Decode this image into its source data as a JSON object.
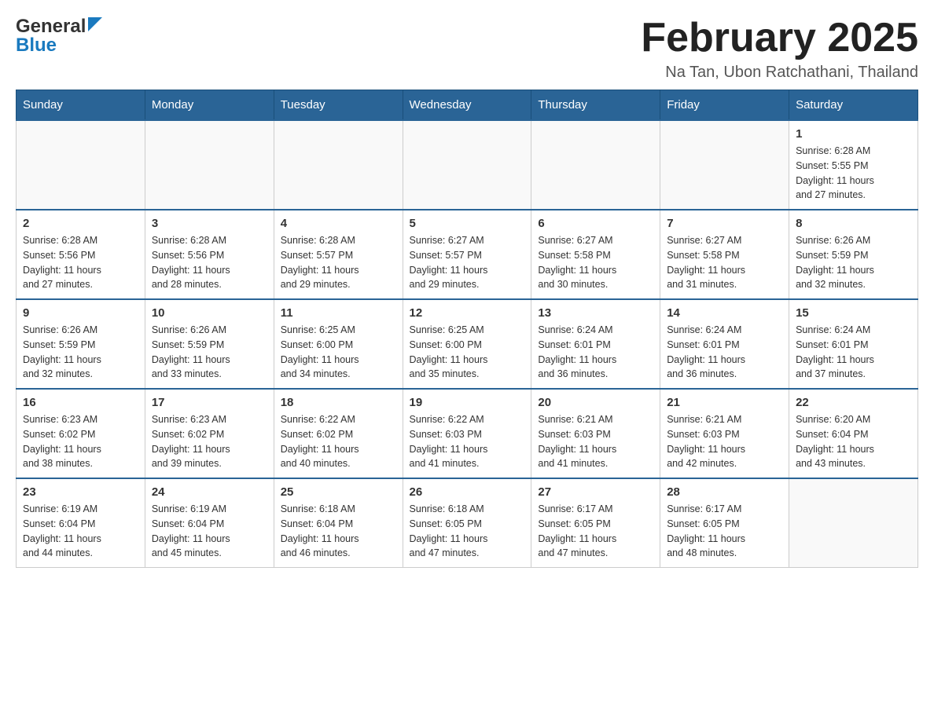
{
  "header": {
    "logo_general": "General",
    "logo_blue": "Blue",
    "month_title": "February 2025",
    "location": "Na Tan, Ubon Ratchathani, Thailand"
  },
  "days_of_week": [
    "Sunday",
    "Monday",
    "Tuesday",
    "Wednesday",
    "Thursday",
    "Friday",
    "Saturday"
  ],
  "weeks": [
    [
      {
        "day": "",
        "info": ""
      },
      {
        "day": "",
        "info": ""
      },
      {
        "day": "",
        "info": ""
      },
      {
        "day": "",
        "info": ""
      },
      {
        "day": "",
        "info": ""
      },
      {
        "day": "",
        "info": ""
      },
      {
        "day": "1",
        "info": "Sunrise: 6:28 AM\nSunset: 5:55 PM\nDaylight: 11 hours\nand 27 minutes."
      }
    ],
    [
      {
        "day": "2",
        "info": "Sunrise: 6:28 AM\nSunset: 5:56 PM\nDaylight: 11 hours\nand 27 minutes."
      },
      {
        "day": "3",
        "info": "Sunrise: 6:28 AM\nSunset: 5:56 PM\nDaylight: 11 hours\nand 28 minutes."
      },
      {
        "day": "4",
        "info": "Sunrise: 6:28 AM\nSunset: 5:57 PM\nDaylight: 11 hours\nand 29 minutes."
      },
      {
        "day": "5",
        "info": "Sunrise: 6:27 AM\nSunset: 5:57 PM\nDaylight: 11 hours\nand 29 minutes."
      },
      {
        "day": "6",
        "info": "Sunrise: 6:27 AM\nSunset: 5:58 PM\nDaylight: 11 hours\nand 30 minutes."
      },
      {
        "day": "7",
        "info": "Sunrise: 6:27 AM\nSunset: 5:58 PM\nDaylight: 11 hours\nand 31 minutes."
      },
      {
        "day": "8",
        "info": "Sunrise: 6:26 AM\nSunset: 5:59 PM\nDaylight: 11 hours\nand 32 minutes."
      }
    ],
    [
      {
        "day": "9",
        "info": "Sunrise: 6:26 AM\nSunset: 5:59 PM\nDaylight: 11 hours\nand 32 minutes."
      },
      {
        "day": "10",
        "info": "Sunrise: 6:26 AM\nSunset: 5:59 PM\nDaylight: 11 hours\nand 33 minutes."
      },
      {
        "day": "11",
        "info": "Sunrise: 6:25 AM\nSunset: 6:00 PM\nDaylight: 11 hours\nand 34 minutes."
      },
      {
        "day": "12",
        "info": "Sunrise: 6:25 AM\nSunset: 6:00 PM\nDaylight: 11 hours\nand 35 minutes."
      },
      {
        "day": "13",
        "info": "Sunrise: 6:24 AM\nSunset: 6:01 PM\nDaylight: 11 hours\nand 36 minutes."
      },
      {
        "day": "14",
        "info": "Sunrise: 6:24 AM\nSunset: 6:01 PM\nDaylight: 11 hours\nand 36 minutes."
      },
      {
        "day": "15",
        "info": "Sunrise: 6:24 AM\nSunset: 6:01 PM\nDaylight: 11 hours\nand 37 minutes."
      }
    ],
    [
      {
        "day": "16",
        "info": "Sunrise: 6:23 AM\nSunset: 6:02 PM\nDaylight: 11 hours\nand 38 minutes."
      },
      {
        "day": "17",
        "info": "Sunrise: 6:23 AM\nSunset: 6:02 PM\nDaylight: 11 hours\nand 39 minutes."
      },
      {
        "day": "18",
        "info": "Sunrise: 6:22 AM\nSunset: 6:02 PM\nDaylight: 11 hours\nand 40 minutes."
      },
      {
        "day": "19",
        "info": "Sunrise: 6:22 AM\nSunset: 6:03 PM\nDaylight: 11 hours\nand 41 minutes."
      },
      {
        "day": "20",
        "info": "Sunrise: 6:21 AM\nSunset: 6:03 PM\nDaylight: 11 hours\nand 41 minutes."
      },
      {
        "day": "21",
        "info": "Sunrise: 6:21 AM\nSunset: 6:03 PM\nDaylight: 11 hours\nand 42 minutes."
      },
      {
        "day": "22",
        "info": "Sunrise: 6:20 AM\nSunset: 6:04 PM\nDaylight: 11 hours\nand 43 minutes."
      }
    ],
    [
      {
        "day": "23",
        "info": "Sunrise: 6:19 AM\nSunset: 6:04 PM\nDaylight: 11 hours\nand 44 minutes."
      },
      {
        "day": "24",
        "info": "Sunrise: 6:19 AM\nSunset: 6:04 PM\nDaylight: 11 hours\nand 45 minutes."
      },
      {
        "day": "25",
        "info": "Sunrise: 6:18 AM\nSunset: 6:04 PM\nDaylight: 11 hours\nand 46 minutes."
      },
      {
        "day": "26",
        "info": "Sunrise: 6:18 AM\nSunset: 6:05 PM\nDaylight: 11 hours\nand 47 minutes."
      },
      {
        "day": "27",
        "info": "Sunrise: 6:17 AM\nSunset: 6:05 PM\nDaylight: 11 hours\nand 47 minutes."
      },
      {
        "day": "28",
        "info": "Sunrise: 6:17 AM\nSunset: 6:05 PM\nDaylight: 11 hours\nand 48 minutes."
      },
      {
        "day": "",
        "info": ""
      }
    ]
  ]
}
